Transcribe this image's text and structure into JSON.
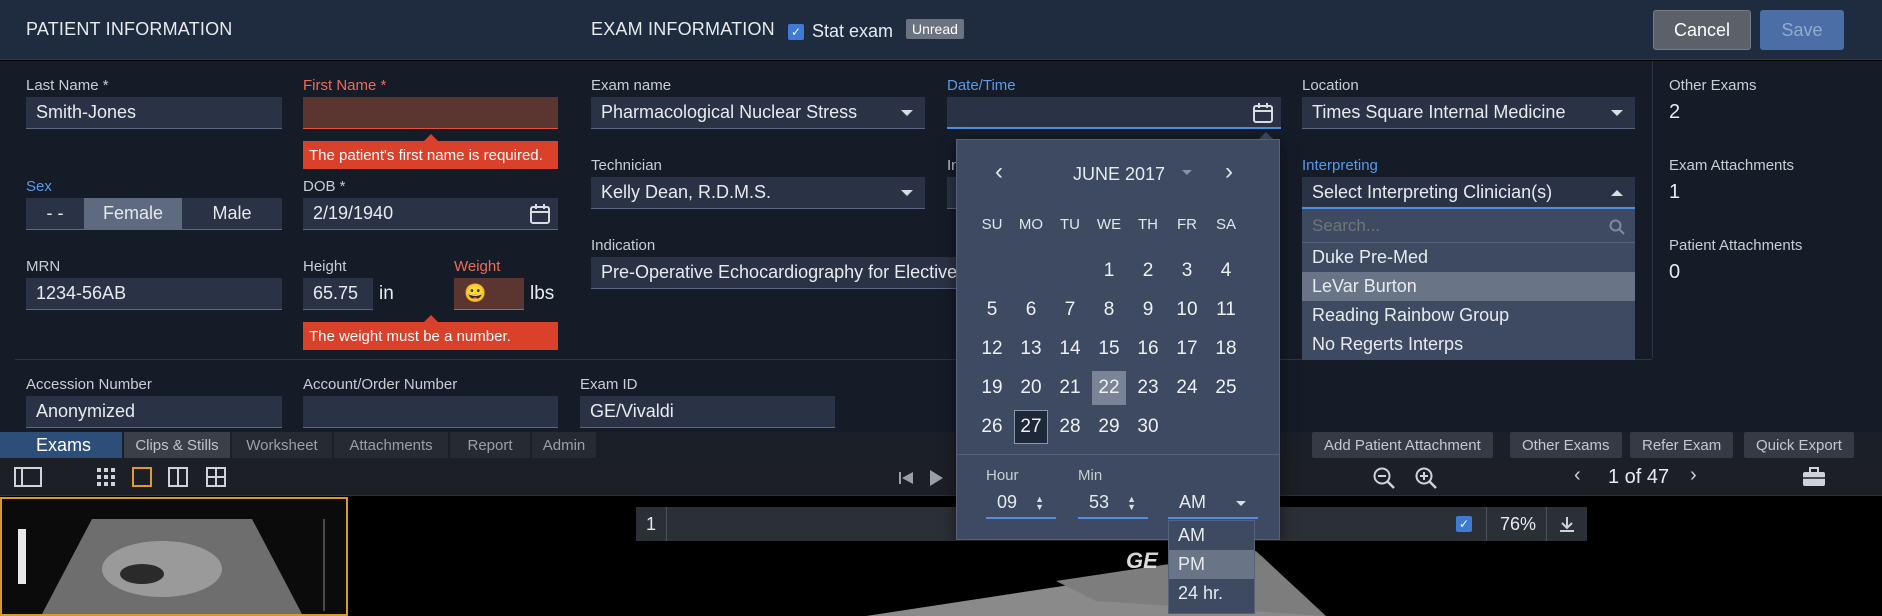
{
  "header": {
    "patient_title": "PATIENT INFORMATION",
    "exam_title": "EXAM INFORMATION",
    "stat_exam_label": "Stat exam",
    "unread_badge": "Unread",
    "cancel_label": "Cancel",
    "save_label": "Save"
  },
  "patient": {
    "last_name_label": "Last Name *",
    "last_name_value": "Smith-Jones",
    "first_name_label": "First Name *",
    "first_name_value": "",
    "first_name_error": "The patient's first name is required.",
    "sex_label": "Sex",
    "sex_options": [
      "- -",
      "Female",
      "Male"
    ],
    "sex_selected": "Female",
    "dob_label": "DOB *",
    "dob_value": "2/19/1940",
    "mrn_label": "MRN",
    "mrn_value": "1234-56AB",
    "height_label": "Height",
    "height_value": "65.75",
    "height_unit": "in",
    "weight_label": "Weight",
    "weight_value": "😀",
    "weight_unit": "lbs",
    "weight_error": "The weight must be a number."
  },
  "exam": {
    "exam_name_label": "Exam name",
    "exam_name_value": "Pharmacological Nuclear Stress",
    "datetime_label": "Date/Time",
    "datetime_value": "",
    "location_label": "Location",
    "location_value": "Times Square Internal Medicine",
    "technician_label": "Technician",
    "technician_value": "Kelly Dean, R.D.M.S.",
    "hidden_label_fragment": "In",
    "interpreting_label": "Interpreting",
    "interpreting_value": "Select Interpreting Clinician(s)",
    "interpreting_search_placeholder": "Search...",
    "interpreting_options": [
      "Duke Pre-Med",
      "LeVar Burton",
      "Reading Rainbow Group",
      "No Regerts Interps"
    ],
    "interpreting_highlighted": "LeVar Burton",
    "indication_label": "Indication",
    "indication_value": "Pre-Operative Echocardiography for Elective"
  },
  "summary": {
    "other_exams_label": "Other Exams",
    "other_exams_value": "2",
    "exam_attachments_label": "Exam Attachments",
    "exam_attachments_value": "1",
    "patient_attachments_label": "Patient Attachments",
    "patient_attachments_value": "0"
  },
  "ids": {
    "accession_label": "Accession Number",
    "accession_value": "Anonymized",
    "account_label": "Account/Order Number",
    "account_value": "",
    "exam_id_label": "Exam ID",
    "exam_id_value": "GE/Vivaldi"
  },
  "calendar": {
    "month_label": "JUNE 2017",
    "days_of_week": [
      "SU",
      "MO",
      "TU",
      "WE",
      "TH",
      "FR",
      "SA"
    ],
    "first_weekday_index": 3,
    "days_in_month": 30,
    "selected_day": 27,
    "today_day": 22,
    "hour_label": "Hour",
    "hour_value": "09",
    "min_label": "Min",
    "min_value": "53",
    "ampm_value": "AM",
    "ampm_options": [
      "AM",
      "PM",
      "24 hr."
    ],
    "ampm_highlighted": "PM"
  },
  "bottom": {
    "tab_exams": "Exams",
    "tab_clips": "Clips & Stills",
    "tab_worksheet": "Worksheet",
    "tab_attachments": "Attachments",
    "tab_report": "Report",
    "tab_admin": "Admin",
    "btn_add_patient_attachment": "Add Patient Attachment",
    "btn_other_exams": "Other Exams",
    "btn_refer_exam": "Refer Exam",
    "btn_quick_export": "Quick Export",
    "pager_text": "1 of 47",
    "viewer_index": "1",
    "zoom_value": "76%",
    "watermark": "GE"
  }
}
